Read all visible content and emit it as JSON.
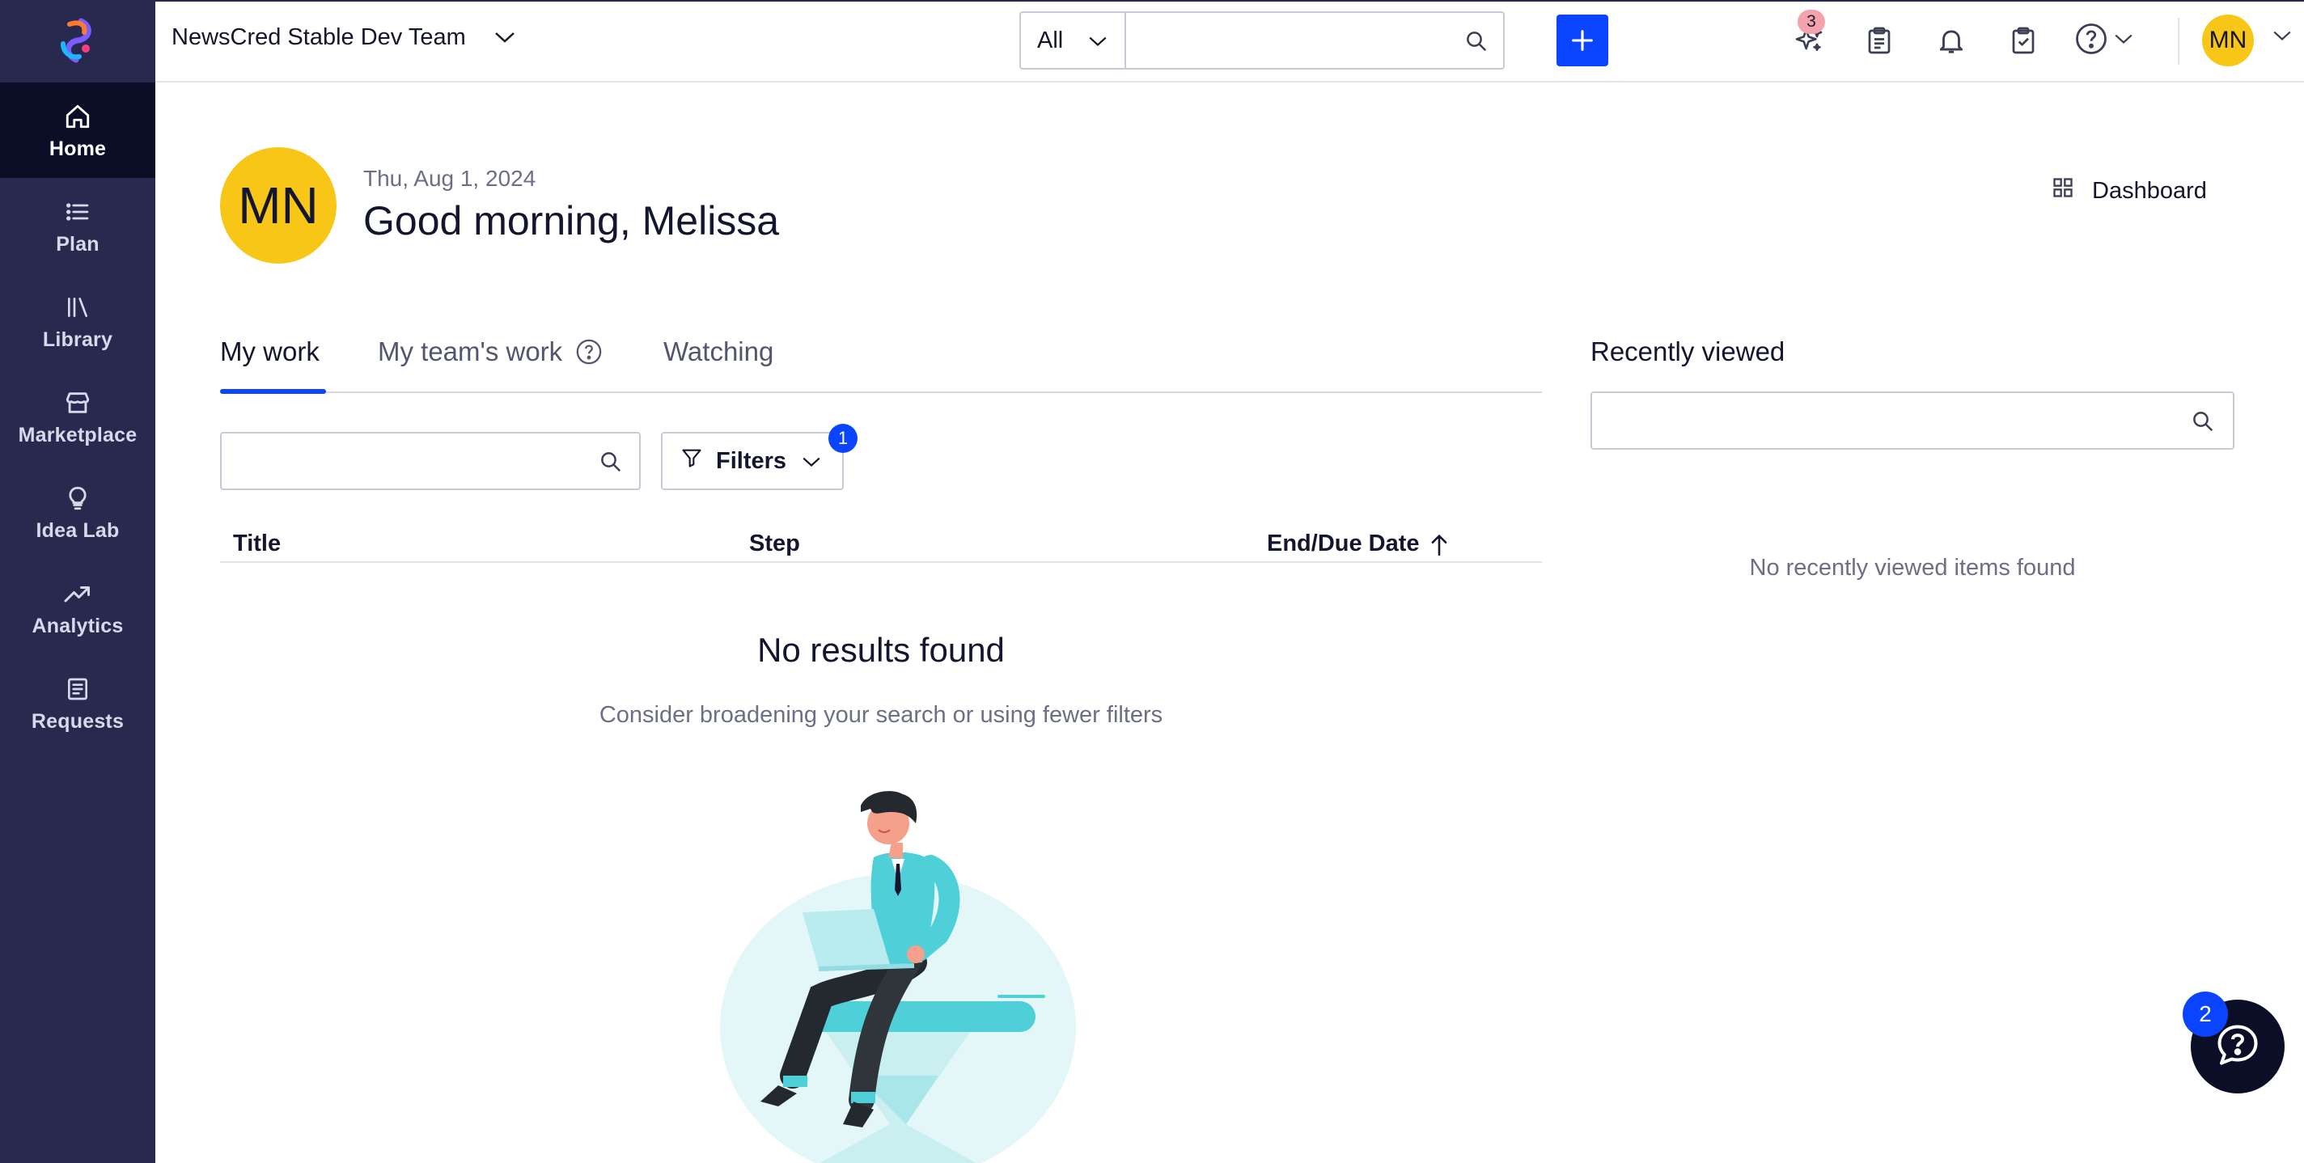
{
  "sidebar": {
    "logo_icon": "brand-logo-icon",
    "items": [
      {
        "label": "Home",
        "icon": "home-icon",
        "active": true
      },
      {
        "label": "Plan",
        "icon": "list-icon"
      },
      {
        "label": "Library",
        "icon": "library-icon"
      },
      {
        "label": "Marketplace",
        "icon": "store-icon"
      },
      {
        "label": "Idea Lab",
        "icon": "lightbulb-icon"
      },
      {
        "label": "Analytics",
        "icon": "trend-icon"
      },
      {
        "label": "Requests",
        "icon": "document-icon"
      }
    ]
  },
  "header": {
    "team_name": "NewsCred Stable Dev Team",
    "search_scope": "All",
    "search_value": "",
    "notifications_count": "3",
    "user_initials": "MN",
    "accent_color": "#0a44ff"
  },
  "greeting": {
    "avatar_initials": "MN",
    "date": "Thu, Aug 1, 2024",
    "message": "Good morning, Melissa",
    "dashboard_label": "Dashboard"
  },
  "tabs": [
    {
      "label": "My work",
      "active": true
    },
    {
      "label": "My team's work",
      "has_help": true
    },
    {
      "label": "Watching"
    }
  ],
  "work": {
    "search_value": "",
    "filters_label": "Filters",
    "filters_count": "1",
    "columns": [
      "Title",
      "Step",
      "End/Due Date"
    ],
    "sort_column": "End/Due Date",
    "sort_direction": "ascending",
    "empty_title": "No results found",
    "empty_subtitle": "Consider broadening your search or using fewer filters"
  },
  "recently_viewed": {
    "title": "Recently viewed",
    "search_value": "",
    "empty_text": "No recently viewed items found"
  },
  "chat": {
    "badge_count": "2",
    "icon": "chat-help-icon"
  }
}
